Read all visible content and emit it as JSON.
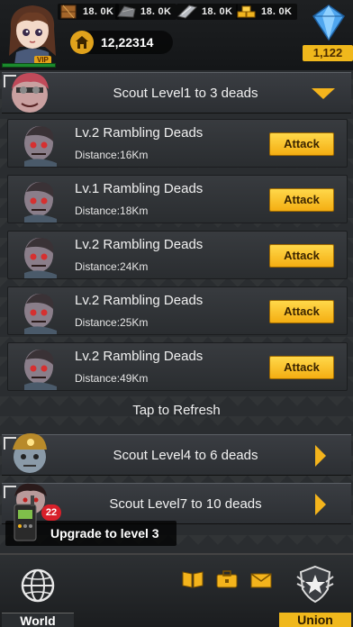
{
  "top_bar": {
    "resources": [
      {
        "icon": "wood-crate-icon",
        "value": "18. 0K"
      },
      {
        "icon": "stone-icon",
        "value": "18. 0K"
      },
      {
        "icon": "steel-icon",
        "value": "18. 0K"
      },
      {
        "icon": "gold-bars-icon",
        "value": "18. 0K"
      }
    ],
    "power": "12,22314",
    "vip_label": "VIP",
    "gems": "1,122"
  },
  "scout_groups": [
    {
      "title": "Scout Level1 to 3 deads",
      "expanded": true
    },
    {
      "title": "Scout Level4 to 6 deads",
      "expanded": false
    },
    {
      "title": "Scout Level7 to 10 deads",
      "expanded": false
    }
  ],
  "targets": [
    {
      "name": "Lv.2 Rambling Deads",
      "distance": "Distance:16Km",
      "action": "Attack"
    },
    {
      "name": "Lv.1 Rambling Deads",
      "distance": "Distance:18Km",
      "action": "Attack"
    },
    {
      "name": "Lv.2 Rambling Deads",
      "distance": "Distance:24Km",
      "action": "Attack"
    },
    {
      "name": "Lv.2 Rambling Deads",
      "distance": "Distance:25Km",
      "action": "Attack"
    },
    {
      "name": "Lv.2 Rambling Deads",
      "distance": "Distance:49Km",
      "action": "Attack"
    }
  ],
  "refresh_label": "Tap to Refresh",
  "upgrade": {
    "text": "Upgrade to level 3",
    "badge": "22"
  },
  "bottom_nav": {
    "world": "World",
    "union": "Union",
    "middle_icons": [
      "book-icon",
      "briefcase-icon",
      "mail-icon"
    ]
  },
  "colors": {
    "accent": "#f4b41c",
    "button": "#ffd84a",
    "badge": "#d8202a"
  }
}
